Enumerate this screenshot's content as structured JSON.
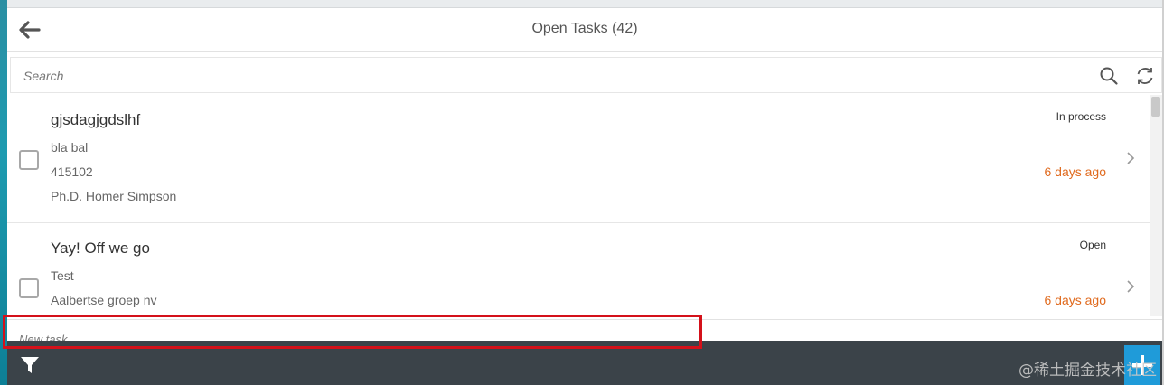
{
  "header": {
    "title": "Open Tasks (42)",
    "back_icon": "arrow-left-icon"
  },
  "search": {
    "placeholder": "Search",
    "value": "",
    "search_icon": "search-icon",
    "refresh_icon": "refresh-icon"
  },
  "tasks": [
    {
      "title": "gjsdagjgdslhf",
      "description": "bla bal",
      "line2": "415102",
      "line3": "Ph.D. Homer Simpson",
      "status": "In process",
      "date": "6 days ago"
    },
    {
      "title": "Yay! Off we go",
      "description": "Test",
      "line2": "Aalbertse groep nv",
      "status": "Open",
      "date": "6 days ago"
    }
  ],
  "new_task": {
    "placeholder": "New task"
  },
  "footer": {
    "filter_icon": "filter-icon",
    "add_icon": "plus-icon"
  },
  "watermark": "@稀土掘金技术社区",
  "colors": {
    "date": "#e06a1e",
    "footer_bg": "#3b4349",
    "add_button": "#1f9bd9",
    "highlight": "#d4111a"
  }
}
